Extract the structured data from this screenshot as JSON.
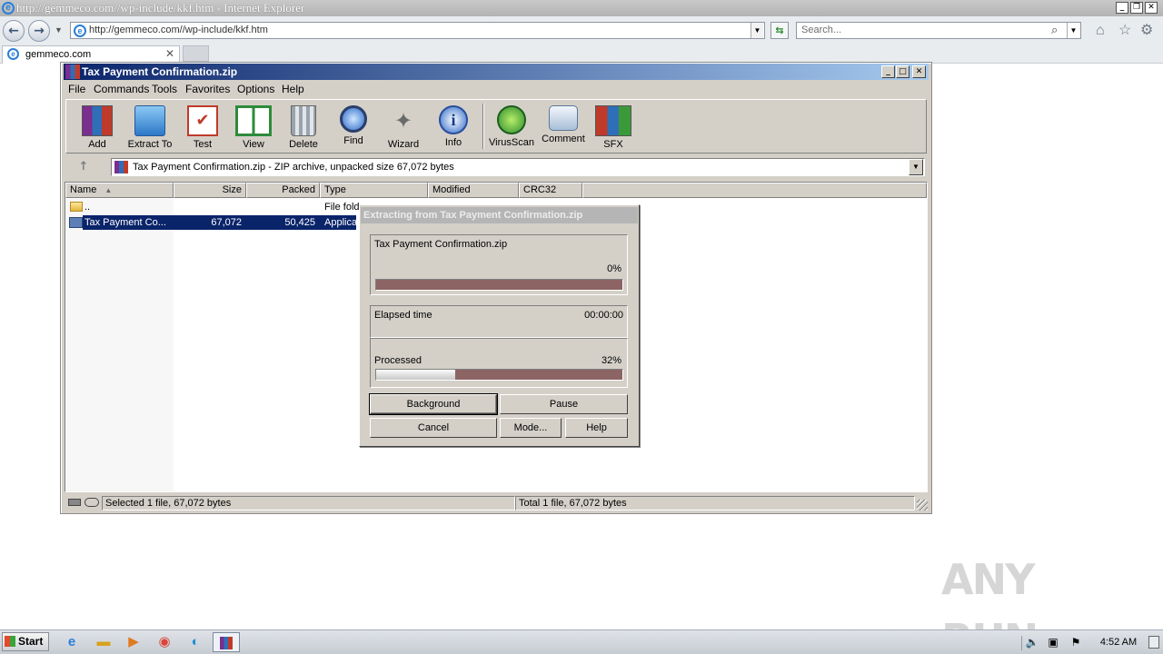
{
  "ie": {
    "title": "http://gemmeco.com//wp-include/kkf.htm - Internet Explorer",
    "address": "http://gemmeco.com//wp-include/kkf.htm",
    "search_placeholder": "Search...",
    "tab_label": "gemmeco.com"
  },
  "winrar": {
    "title": "Tax Payment Confirmation.zip",
    "menu": [
      "File",
      "Commands",
      "Tools",
      "Favorites",
      "Options",
      "Help"
    ],
    "toolbar": [
      "Add",
      "Extract To",
      "Test",
      "View",
      "Delete",
      "Find",
      "Wizard",
      "Info",
      "VirusScan",
      "Comment",
      "SFX"
    ],
    "path": "Tax Payment Confirmation.zip - ZIP archive, unpacked size 67,072 bytes",
    "columns": [
      "Name",
      "Size",
      "Packed",
      "Type",
      "Modified",
      "CRC32"
    ],
    "rows": [
      {
        "name": "..",
        "size": "",
        "packed": "",
        "type": "File fold"
      },
      {
        "name": "Tax Payment Co...",
        "size": "67,072",
        "packed": "50,425",
        "type": "Applicat"
      }
    ],
    "status_left": "Selected 1 file, 67,072 bytes",
    "status_right": "Total 1 file, 67,072 bytes"
  },
  "dialog": {
    "title": "Extracting from Tax Payment Confirmation.zip",
    "file": "Tax Payment Confirmation.zip",
    "file_percent": "0%",
    "file_progress": 0,
    "elapsed_label": "Elapsed time",
    "elapsed": "00:00:00",
    "processed_label": "Processed",
    "processed_percent": "32%",
    "processed_progress": 0.32,
    "buttons": {
      "background": "Background",
      "pause": "Pause",
      "cancel": "Cancel",
      "mode": "Mode...",
      "help": "Help"
    }
  },
  "taskbar": {
    "start": "Start",
    "clock": "4:52 AM"
  },
  "watermark": "ANY RUN"
}
